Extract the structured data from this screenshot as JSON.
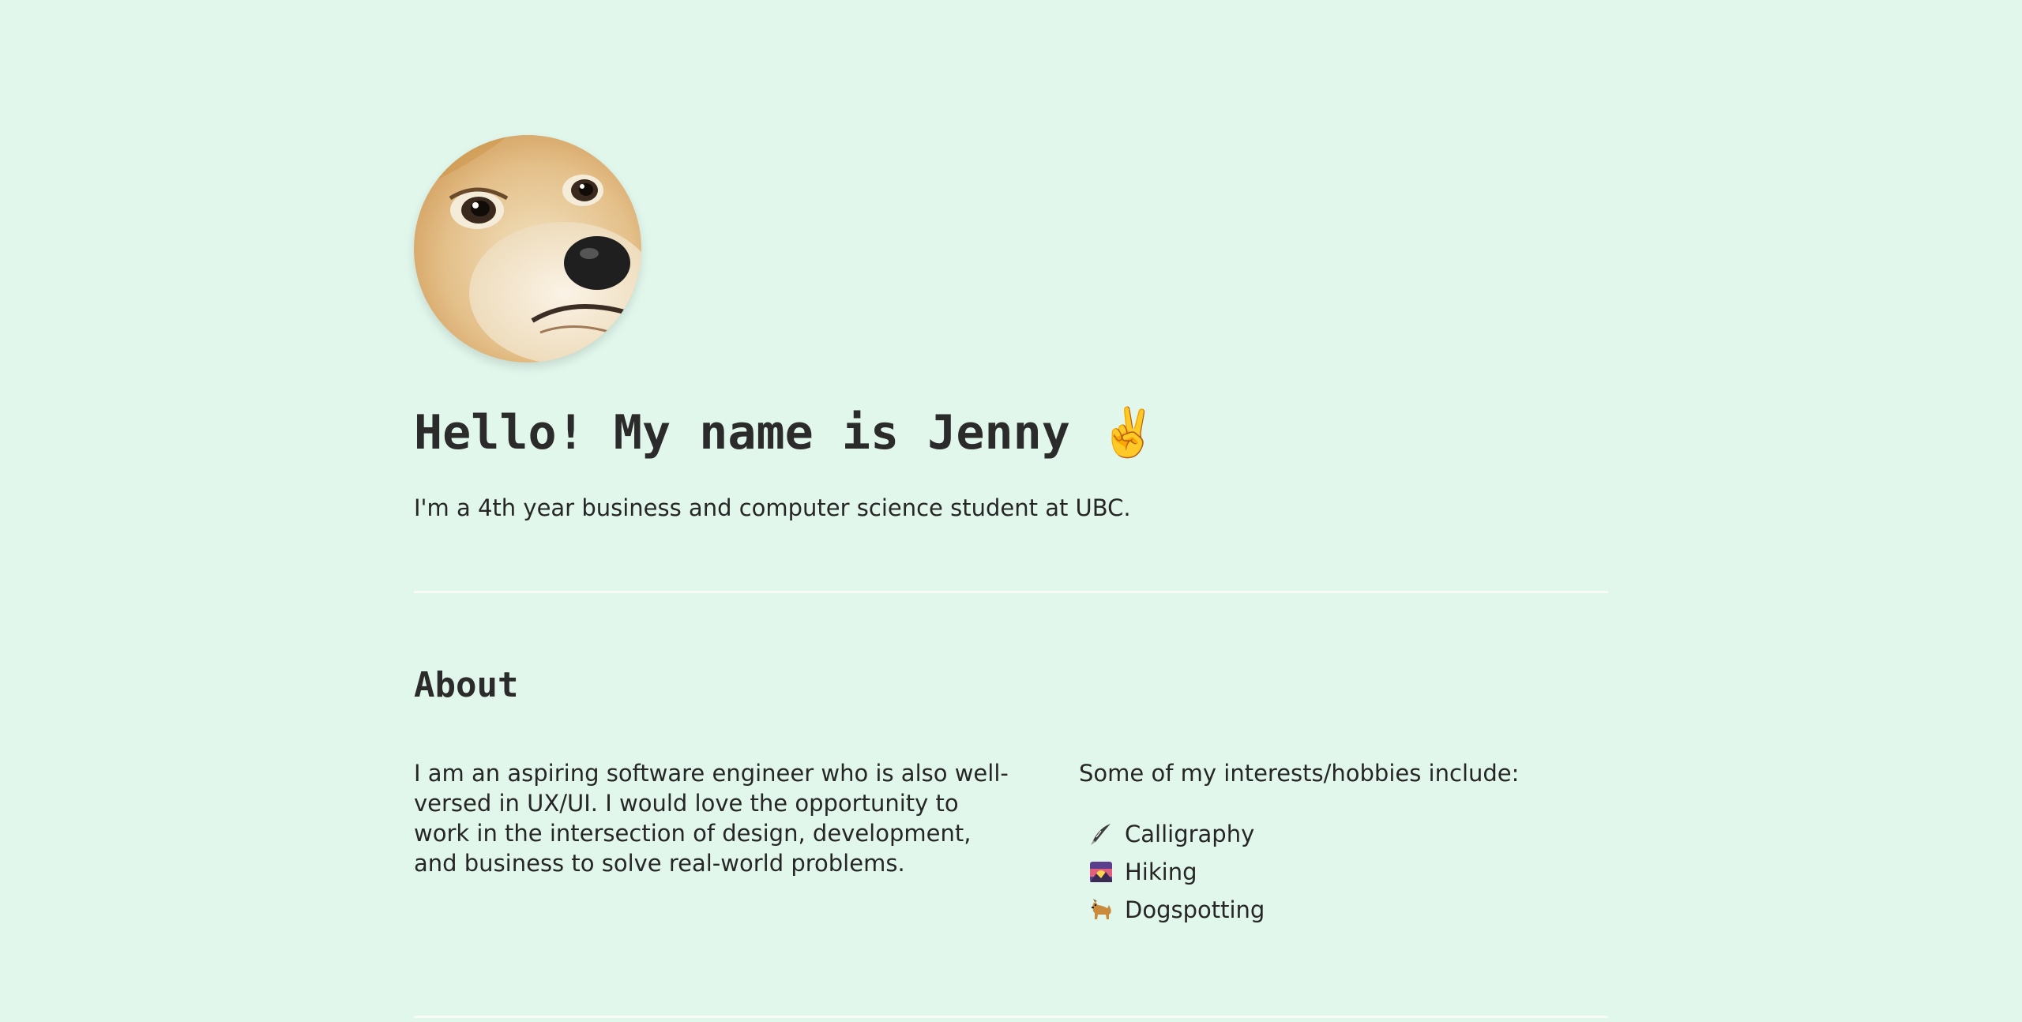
{
  "profile": {
    "avatar_icon": "doge-photo",
    "greeting": "Hello! My name is Jenny",
    "greeting_emoji": "✌️",
    "subtitle": "I'm a 4th year business and computer science student at UBC."
  },
  "about": {
    "title": "About",
    "description": "I am an aspiring software engineer who is also well-versed in UX/UI. I would love the opportunity to work in the intersection of design, development, and business to solve real-world problems.",
    "interests_intro": "Some of my interests/hobbies include:",
    "hobbies": [
      {
        "icon": "feather-pen-icon",
        "label": "Calligraphy"
      },
      {
        "icon": "sunrise-mountain-icon",
        "label": "Hiking"
      },
      {
        "icon": "dog-icon",
        "label": "Dogspotting"
      }
    ]
  },
  "colors": {
    "background": "#e1f7ec",
    "text": "#2b2b2b",
    "divider": "#f7fcf9"
  }
}
